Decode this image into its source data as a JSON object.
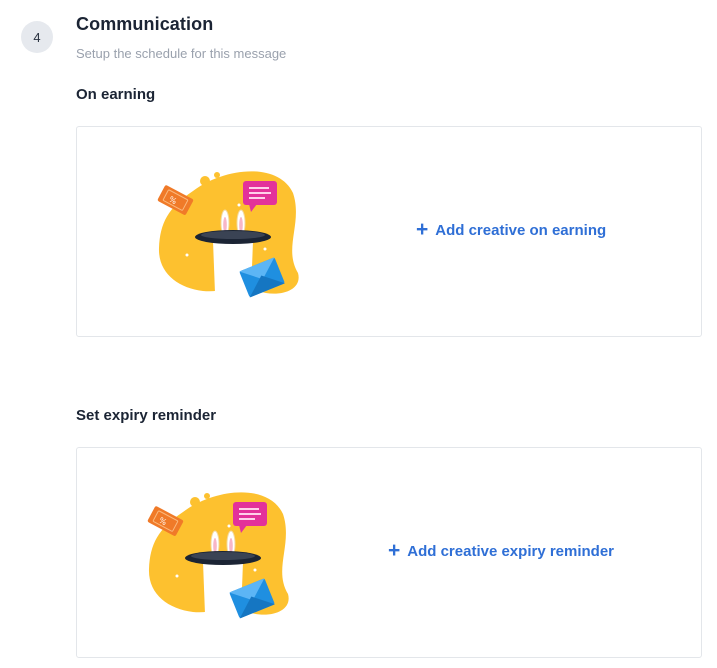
{
  "step": {
    "number": "4",
    "title": "Communication",
    "subtitle": "Setup the schedule for this message"
  },
  "sections": [
    {
      "heading": "On earning",
      "action_label": "Add creative on earning",
      "action_icon": "plus-icon",
      "illustration": "magic-hat-illustration"
    },
    {
      "heading": "Set expiry reminder",
      "action_label": "Add creative expiry reminder",
      "action_icon": "plus-icon",
      "illustration": "magic-hat-illustration"
    }
  ],
  "colors": {
    "accent": "#2f6fd6",
    "blob": "#fdc12f",
    "ticket": "#f07a28",
    "chat_bubble": "#e3319a",
    "envelope": "#1f8fe0",
    "text_primary": "#1b2434",
    "text_muted": "#9aa1ad"
  }
}
